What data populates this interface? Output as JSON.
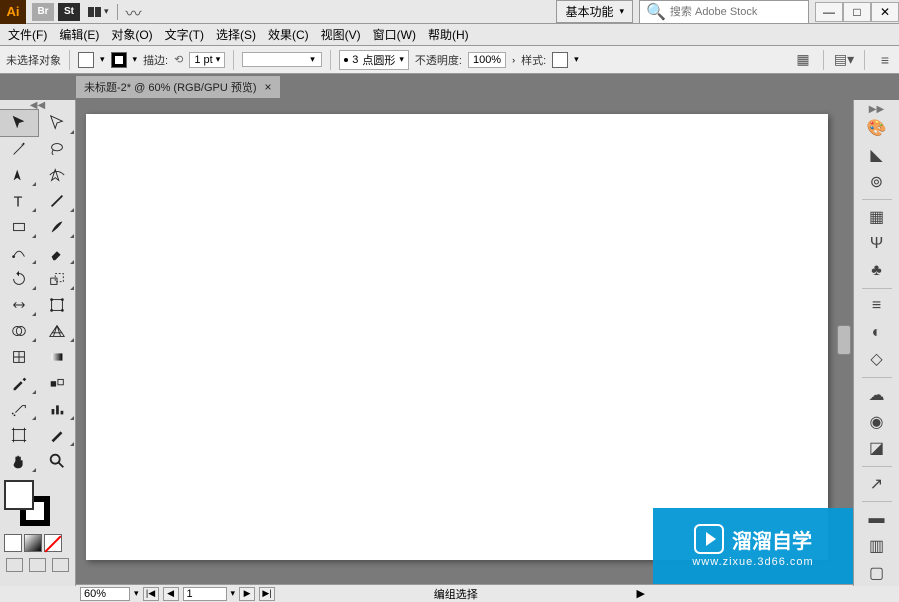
{
  "titleBar": {
    "aiLogo": "Ai",
    "brBadge": "Br",
    "stBadge": "St",
    "workspaceLabel": "基本功能",
    "searchPlaceholder": "搜索 Adobe Stock",
    "minimize": "—",
    "maximize": "□",
    "close": "✕"
  },
  "menu": {
    "file": "文件(F)",
    "edit": "编辑(E)",
    "object": "对象(O)",
    "type": "文字(T)",
    "select": "选择(S)",
    "effect": "效果(C)",
    "view": "视图(V)",
    "window": "窗口(W)",
    "help": "帮助(H)"
  },
  "options": {
    "noSelection": "未选择对象",
    "strokeLabel": "描边:",
    "strokeWeight": "1 pt",
    "brushSize": "3",
    "brushShape": "点圆形",
    "opacityLabel": "不透明度:",
    "opacityValue": "100%",
    "styleLabel": "样式:"
  },
  "docTab": {
    "title": "未标题-2* @ 60% (RGB/GPU 预览)"
  },
  "statusBar": {
    "zoom": "60%",
    "artboardNum": "1",
    "selectionMode": "编组选择"
  },
  "watermark": {
    "brand": "溜溜自学",
    "url": "www.zixue.3d66.com"
  }
}
